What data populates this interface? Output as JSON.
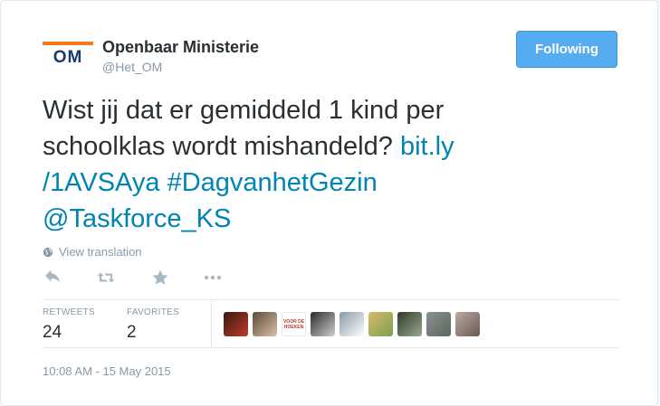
{
  "account": {
    "logo_text": "OM",
    "name": "Openbaar Ministerie",
    "handle": "@Het_OM"
  },
  "follow_button": {
    "label": "Following"
  },
  "tweet": {
    "text_parts": [
      "Wist jij dat er gemiddeld 1 kind per schoolklas wordt mishandeld? ",
      "bit.ly /1AVSAya",
      " ",
      "#DagvanhetGezin",
      " ",
      "@Taskforce_KS"
    ]
  },
  "translation": {
    "label": "View translation"
  },
  "actions": [
    "reply-icon",
    "retweet-icon",
    "favorite-icon",
    "more-icon"
  ],
  "stats": {
    "retweets_label": "RETWEETS",
    "retweets_value": "24",
    "favorites_label": "FAVORITES",
    "favorites_value": "2"
  },
  "avatars": [
    {
      "name": "avatar-1",
      "colors": [
        "#3a1a10",
        "#c0392b"
      ]
    },
    {
      "name": "avatar-2",
      "colors": [
        "#5a4a3a",
        "#d9c2a5"
      ]
    },
    {
      "name": "avatar-3",
      "colors": [
        "#ffffff",
        "#c0392b"
      ],
      "text": "VOOR DE HOEKEN"
    },
    {
      "name": "avatar-4",
      "colors": [
        "#2b2b2b",
        "#cfcfcf"
      ]
    },
    {
      "name": "avatar-5",
      "colors": [
        "#8a9aa6",
        "#ffffff"
      ]
    },
    {
      "name": "avatar-6",
      "colors": [
        "#d9b86a",
        "#7aa34f"
      ]
    },
    {
      "name": "avatar-7",
      "colors": [
        "#2f3b2a",
        "#9aa88e"
      ]
    },
    {
      "name": "avatar-8",
      "colors": [
        "#8a8f94",
        "#5a6a5a"
      ]
    },
    {
      "name": "avatar-9",
      "colors": [
        "#b9a9a0",
        "#6c5a52"
      ]
    }
  ],
  "timestamp": "10:08 AM - 15 May 2015",
  "colors": {
    "accent": "#55acee",
    "link": "#0084b4",
    "muted": "#8899a6",
    "logo_orange": "#f47a20",
    "logo_navy": "#1b3a6b"
  }
}
